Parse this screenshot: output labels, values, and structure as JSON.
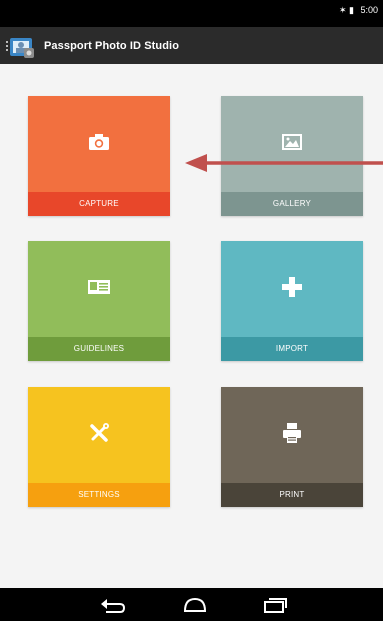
{
  "status_bar": {
    "icons": "✶ ▮",
    "time": "5:00"
  },
  "app": {
    "title": "Passport Photo ID Studio"
  },
  "tiles": [
    {
      "label": "CAPTURE",
      "icon": "camera-icon",
      "color": "#f2703f",
      "label_color": "#e8472a"
    },
    {
      "label": "GALLERY",
      "icon": "image-icon",
      "color": "#9fb3ae",
      "label_color": "#7d9590"
    },
    {
      "label": "GUIDELINES",
      "icon": "id-card-icon",
      "color": "#91bd5a",
      "label_color": "#6f9c3c"
    },
    {
      "label": "IMPORT",
      "icon": "plus-icon",
      "color": "#5fb8c2",
      "label_color": "#3c99a4"
    },
    {
      "label": "SETTINGS",
      "icon": "tools-icon",
      "color": "#f6c31f",
      "label_color": "#f6a00f"
    },
    {
      "label": "PRINT",
      "icon": "printer-icon",
      "color": "#6f6658",
      "label_color": "#4a4439"
    }
  ],
  "colors": {
    "action_bar": "#2b2b2b",
    "background": "#f4f4f4",
    "annotation_arrow": "#c0504d"
  }
}
